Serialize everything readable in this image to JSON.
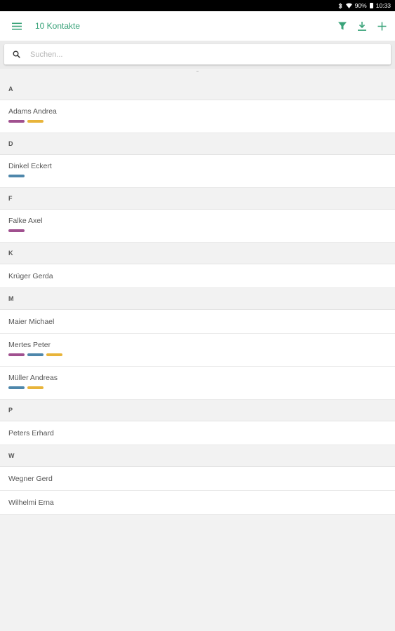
{
  "status_bar": {
    "battery": "90%",
    "time": "10:33"
  },
  "app_bar": {
    "title": "10 Kontakte"
  },
  "search": {
    "placeholder": "Suchen..."
  },
  "colors": {
    "accent": "#3aa37a",
    "purple": "#a0508f",
    "blue": "#4e87ab",
    "yellow": "#e8b43a"
  },
  "sections": [
    {
      "letter": "A",
      "contacts": [
        {
          "name": "Adams Andrea",
          "tags": [
            "purple",
            "yellow"
          ]
        }
      ]
    },
    {
      "letter": "D",
      "contacts": [
        {
          "name": "Dinkel Eckert",
          "tags": [
            "blue"
          ]
        }
      ]
    },
    {
      "letter": "F",
      "contacts": [
        {
          "name": "Falke Axel",
          "tags": [
            "purple"
          ]
        }
      ]
    },
    {
      "letter": "K",
      "contacts": [
        {
          "name": "Krüger Gerda",
          "tags": []
        }
      ]
    },
    {
      "letter": "M",
      "contacts": [
        {
          "name": "Maier Michael",
          "tags": []
        },
        {
          "name": "Mertes Peter",
          "tags": [
            "purple",
            "blue",
            "yellow"
          ]
        },
        {
          "name": "Müller Andreas",
          "tags": [
            "blue",
            "yellow"
          ]
        }
      ]
    },
    {
      "letter": "P",
      "contacts": [
        {
          "name": "Peters Erhard",
          "tags": []
        }
      ]
    },
    {
      "letter": "W",
      "contacts": [
        {
          "name": "Wegner Gerd",
          "tags": []
        },
        {
          "name": "Wilhelmi Erna",
          "tags": []
        }
      ]
    }
  ]
}
